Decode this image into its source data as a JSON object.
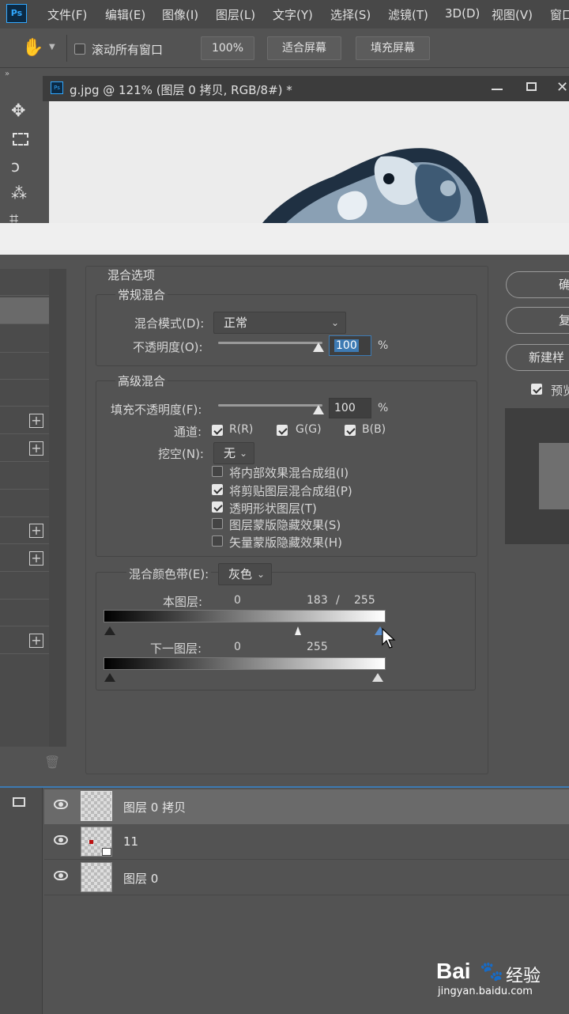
{
  "app": {
    "logo": "Ps"
  },
  "menu": [
    "文件(F)",
    "编辑(E)",
    "图像(I)",
    "图层(L)",
    "文字(Y)",
    "选择(S)",
    "滤镜(T)",
    "3D(D)",
    "视图(V)",
    "窗口"
  ],
  "options": {
    "scroll_all_label": "滚动所有窗口",
    "zoom_100": "100%",
    "fit_screen": "适合屏幕",
    "fill_screen": "填充屏幕"
  },
  "document": {
    "tab_title": "g.jpg @ 121% (图层 0 拷贝, RGB/8#) *",
    "tab_icon": "Ps"
  },
  "dialog": {
    "blend_options_title": "混合选项",
    "general": {
      "title": "常规混合",
      "mode_label": "混合模式(D):",
      "mode_value": "正常",
      "opacity_label": "不透明度(O):",
      "opacity_value": "100",
      "opacity_unit": "%"
    },
    "advanced": {
      "title": "高级混合",
      "fill_label": "填充不透明度(F):",
      "fill_value": "100",
      "fill_unit": "%",
      "channels_label": "通道:",
      "channels": [
        "R(R)",
        "G(G)",
        "B(B)"
      ],
      "knockout_label": "挖空(N):",
      "knockout_value": "无",
      "options": [
        {
          "label": "将内部效果混合成组(I)",
          "checked": false
        },
        {
          "label": "将剪贴图层混合成组(P)",
          "checked": true
        },
        {
          "label": "透明形状图层(T)",
          "checked": true
        },
        {
          "label": "图层蒙版隐藏效果(S)",
          "checked": false
        },
        {
          "label": "矢量蒙版隐藏效果(H)",
          "checked": false
        }
      ]
    },
    "blend_if": {
      "label": "混合颜色带(E):",
      "value": "灰色",
      "this_layer_label": "本图层:",
      "this_layer_low": "0",
      "this_layer_mid": "183",
      "this_layer_sep": "/",
      "this_layer_high": "255",
      "under_layer_label": "下一图层:",
      "under_layer_low": "0",
      "under_layer_high": "255"
    },
    "buttons": {
      "ok": "确定",
      "reset": "复位",
      "new_style": "新建样式...",
      "preview": "预览"
    }
  },
  "layers": [
    {
      "name": "图层 0 拷贝",
      "selected": true
    },
    {
      "name": "11",
      "selected": false
    },
    {
      "name": "图层 0",
      "selected": false
    }
  ],
  "watermark": {
    "brand": "Bai",
    "brand2": "经验",
    "url": "jingyan.baidu.com"
  }
}
